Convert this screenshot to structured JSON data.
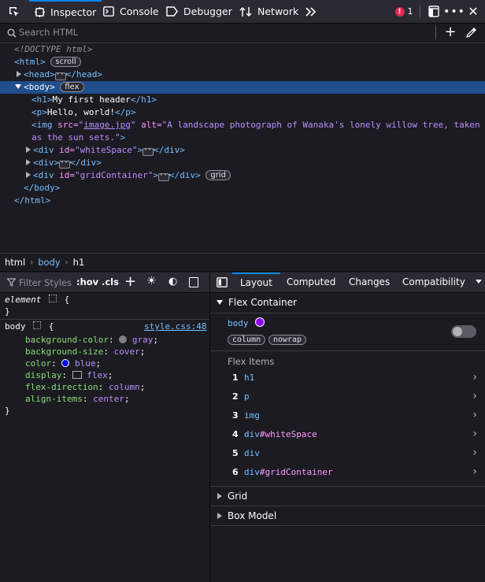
{
  "toolbar": {
    "tabs": [
      {
        "label": "Inspector",
        "icon": "inspector-icon"
      },
      {
        "label": "Console",
        "icon": "console-icon"
      },
      {
        "label": "Debugger",
        "icon": "debugger-icon"
      },
      {
        "label": "Network",
        "icon": "network-icon"
      }
    ],
    "error_count": "1"
  },
  "search": {
    "placeholder": "Search HTML"
  },
  "markup": {
    "doctype": "<!DOCTYPE html>",
    "html_badge": "scroll",
    "body_badge": "flex",
    "h1_text": "My first header",
    "p_text": "Hello, world!",
    "img_src": "image.jpg",
    "img_alt_line1": "A landscape photograph of Wanaka's lonely willow tree, taken",
    "img_alt_line2": "as the sun sets.",
    "div1_id": "whiteSpace",
    "div3_id": "gridContainer",
    "grid_badge": "grid"
  },
  "breadcrumb": [
    "html",
    "body",
    "h1"
  ],
  "rules": {
    "filter_placeholder": "Filter Styles",
    "hov": ":hov",
    "cls": ".cls",
    "element_selector": "element",
    "body_selector": "body",
    "source": "style.css:48",
    "declarations": [
      {
        "prop": "background-color",
        "value": "gray",
        "swatch": "#808080"
      },
      {
        "prop": "background-size",
        "value": "cover"
      },
      {
        "prop": "color",
        "value": "blue",
        "swatch": "#0000ff"
      },
      {
        "prop": "display",
        "value": "flex"
      },
      {
        "prop": "flex-direction",
        "value": "column"
      },
      {
        "prop": "align-items",
        "value": "center"
      }
    ]
  },
  "side": {
    "tabs": [
      "Layout",
      "Computed",
      "Changes",
      "Compatibility"
    ],
    "flex_container_title": "Flex Container",
    "container_name": "body",
    "container_badges": [
      "column",
      "nowrap"
    ],
    "flex_items_title": "Flex Items",
    "flex_items": [
      {
        "num": "1",
        "name": "h1",
        "id": ""
      },
      {
        "num": "2",
        "name": "p",
        "id": ""
      },
      {
        "num": "3",
        "name": "img",
        "id": ""
      },
      {
        "num": "4",
        "name": "div",
        "id": "#whiteSpace"
      },
      {
        "num": "5",
        "name": "div",
        "id": ""
      },
      {
        "num": "6",
        "name": "div",
        "id": "#gridContainer"
      }
    ],
    "grid_title": "Grid",
    "box_model_title": "Box Model"
  },
  "colors": {
    "accent": "#0a84ff",
    "selected_row": "#204e8a",
    "flex_dot": "#9400ff",
    "error": "#e22850"
  }
}
